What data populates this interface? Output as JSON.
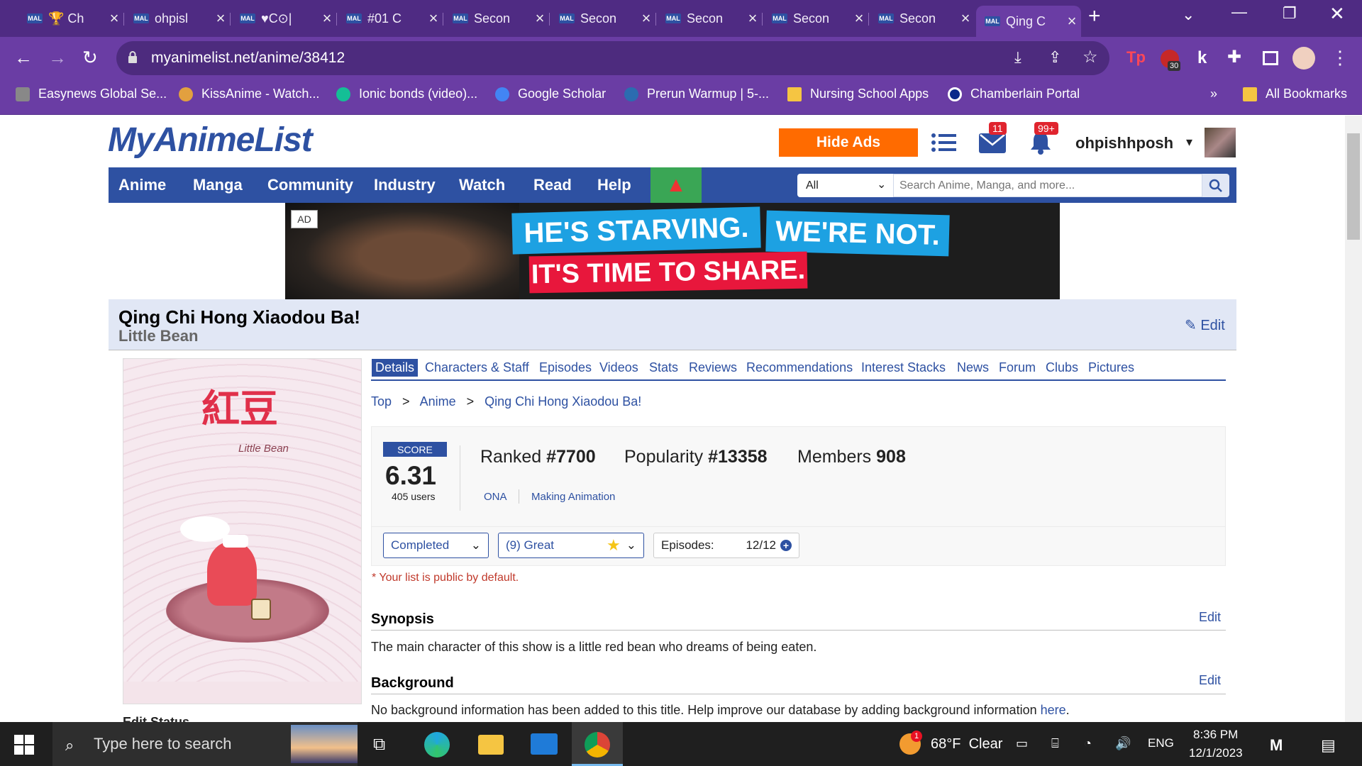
{
  "browser": {
    "tabs": [
      {
        "favicon": "MAL",
        "title": "🏆 Ch"
      },
      {
        "favicon": "MAL",
        "title": "ohpisl"
      },
      {
        "favicon": "MAL",
        "title": "♥C⊙|"
      },
      {
        "favicon": "MAL",
        "title": "#01 C"
      },
      {
        "favicon": "MAL",
        "title": "Secon"
      },
      {
        "favicon": "MAL",
        "title": "Secon"
      },
      {
        "favicon": "MAL",
        "title": "Secon"
      },
      {
        "favicon": "MAL",
        "title": "Secon"
      },
      {
        "favicon": "MAL",
        "title": "Secon"
      },
      {
        "favicon": "MAL",
        "title": "Qing C"
      }
    ],
    "url": "myanimelist.net/anime/38412",
    "bookmarks": [
      "Easynews Global Se...",
      "KissAnime - Watch...",
      "Ionic bonds (video)...",
      "Google Scholar",
      "Prerun Warmup | 5-...",
      "Nursing School Apps",
      "Chamberlain Portal"
    ],
    "all_bookmarks": "All Bookmarks",
    "ext_badge": "30"
  },
  "site": {
    "logo": "MyAnimeList",
    "hide_ads": "Hide Ads",
    "mail_count": "11",
    "notif_count": "99+",
    "username": "ohpishhposh",
    "nav": [
      "Anime",
      "Manga",
      "Community",
      "Industry",
      "Watch",
      "Read",
      "Help"
    ],
    "search_select": "All",
    "search_placeholder": "Search Anime, Manga, and more..."
  },
  "ad": {
    "label": "AD",
    "line1a": "HE'S STARVING.",
    "line1b": "WE'RE NOT.",
    "line2": "IT'S TIME TO SHARE."
  },
  "anime": {
    "title": "Qing Chi Hong Xiaodou Ba!",
    "english_title": "Little Bean",
    "edit": "Edit",
    "poster_text": "Little Bean",
    "tabs": [
      "Details",
      "Characters & Staff",
      "Episodes",
      "Videos",
      "Stats",
      "Reviews",
      "Recommendations",
      "Interest Stacks",
      "News",
      "Forum",
      "Clubs",
      "Pictures"
    ],
    "breadcrumb": [
      "Top",
      "Anime",
      "Qing Chi Hong Xiaodou Ba!"
    ],
    "score_label": "SCORE",
    "score": "6.31",
    "score_users": "405 users",
    "ranked_label": "Ranked",
    "ranked": "#7700",
    "popularity_label": "Popularity",
    "popularity": "#13358",
    "members_label": "Members",
    "members": "908",
    "type": "ONA",
    "studio": "Making Animation",
    "status": "Completed",
    "user_score": "(9) Great",
    "episodes_label": "Episodes:",
    "episodes": "12/12",
    "public_note": "* Your list is public by default.",
    "synopsis_head": "Synopsis",
    "synopsis": "The main character of this show is a little red bean who dreams of being eaten.",
    "background_head": "Background",
    "background": "No background information has been added to this title. Help improve our database by adding background information",
    "background_link": "here",
    "background_end": ".",
    "section_edit": "Edit",
    "edit_status": "Edit Status"
  },
  "taskbar": {
    "search_placeholder": "Type here to search",
    "weather": "68°F  Clear",
    "weather_badge": "1",
    "language": "ENG",
    "time": "8:36 PM",
    "date": "12/1/2023"
  },
  "colors": {
    "mal_blue": "#2e51a2",
    "hide_ads": "#ff6b00",
    "chrome_purple": "#6a3da4"
  }
}
